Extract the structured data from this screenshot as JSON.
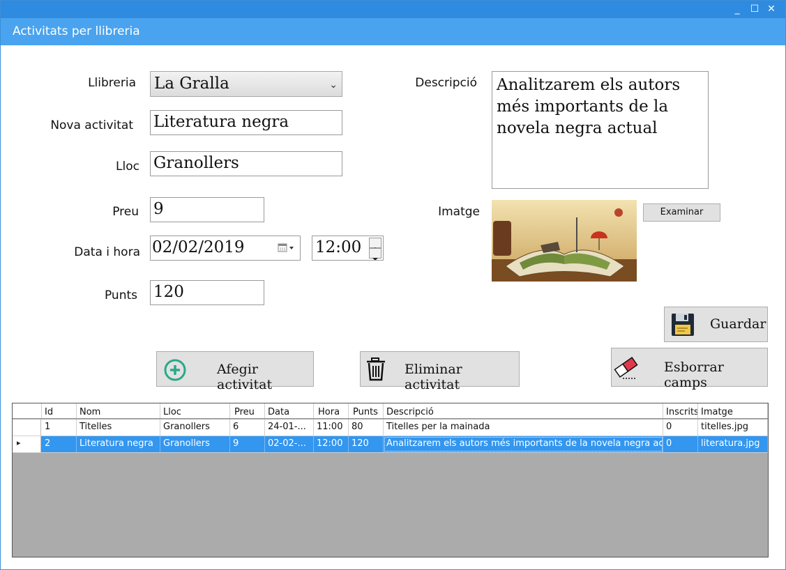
{
  "window": {
    "title": "Activitats per llibreria",
    "controls": {
      "minimize": "_",
      "maximize": "☐",
      "close": "✕"
    }
  },
  "form": {
    "labels": {
      "llibreria": "Llibreria",
      "nova_activitat": "Nova activitat",
      "lloc": "Lloc",
      "preu": "Preu",
      "data_hora": "Data i hora",
      "punts": "Punts",
      "descripcio": "Descripció",
      "imatge": "Imatge"
    },
    "llibreria_selected": "La Gralla",
    "nova_activitat": "Literatura negra",
    "lloc": "Granollers",
    "preu": "9",
    "data": "02/02/2019",
    "hora": "12:00",
    "punts": "120",
    "descripcio": "Analitzarem els autors més importants de la novela negra actual"
  },
  "buttons": {
    "examinar": "Examinar",
    "guardar": "Guardar",
    "afegir": "Afegir activitat",
    "eliminar": "Eliminar activitat",
    "esborrar": "Esborrar camps"
  },
  "grid": {
    "columns": [
      "Id",
      "Nom",
      "Lloc",
      "Preu",
      "Data",
      "Hora",
      "Punts",
      "Descripció",
      "Inscrits",
      "Imatge"
    ],
    "rows": [
      {
        "id": "1",
        "nom": "Titelles",
        "lloc": "Granollers",
        "preu": "6",
        "data": "24-01-...",
        "hora": "11:00",
        "punts": "80",
        "descripcio": "Titelles per la mainada",
        "inscrits": "0",
        "imatge": "titelles.jpg"
      },
      {
        "id": "2",
        "nom": "Literatura negra",
        "lloc": "Granollers",
        "preu": "9",
        "data": "02-02-...",
        "hora": "12:00",
        "punts": "120",
        "descripcio": "Analitzarem els autors més importants de la novela negra ac...",
        "inscrits": "0",
        "imatge": "literatura.jpg"
      }
    ],
    "selected_row_marker": "▸"
  },
  "colors": {
    "header_blue": "#4aa3ee",
    "titlebar_blue": "#2f8be0",
    "selection_blue": "#3396ef",
    "plus_icon_green": "#2aa889"
  },
  "icons": [
    "minimize-icon",
    "maximize-icon",
    "close-icon",
    "calendar-icon",
    "spin-up-icon",
    "spin-down-icon",
    "floppy-disk-icon",
    "plus-circle-icon",
    "trash-icon",
    "eraser-icon"
  ]
}
